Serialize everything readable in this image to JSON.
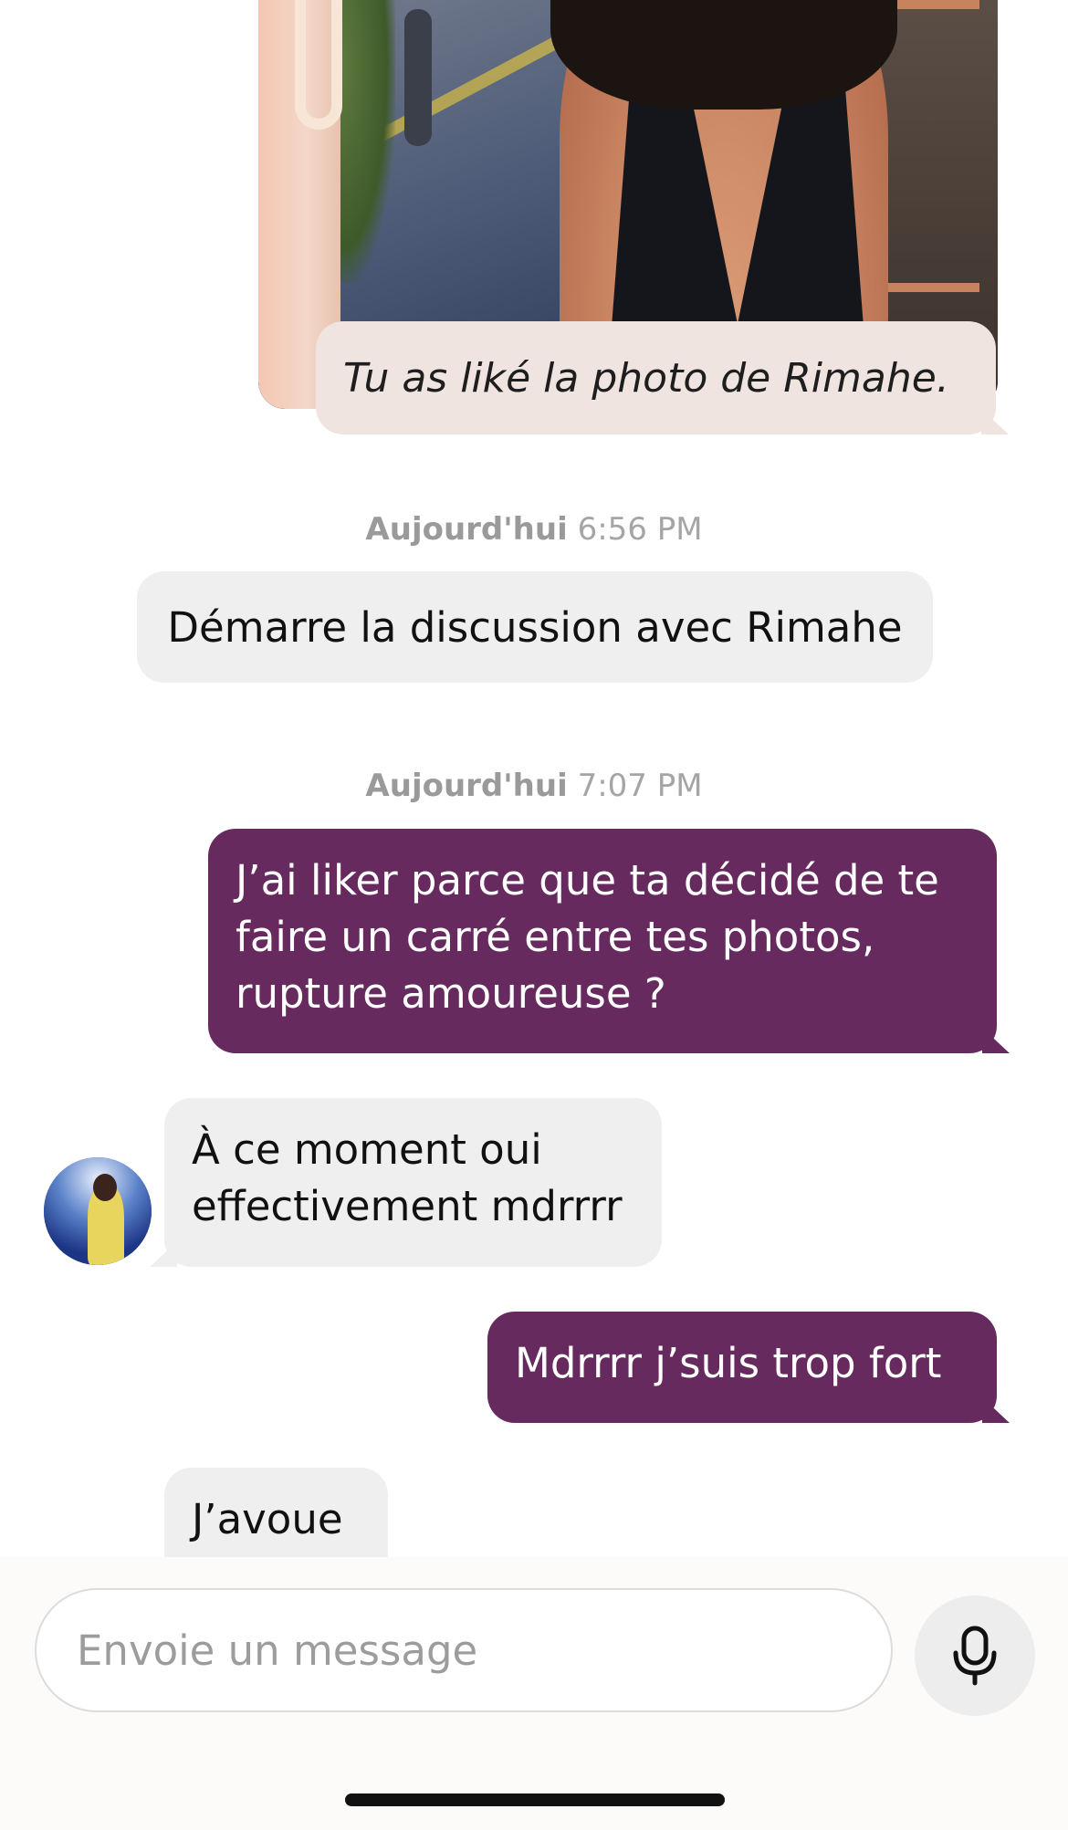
{
  "liked_photo": {
    "caption": "Tu as liké la photo de Rimahe."
  },
  "timestamps": [
    {
      "day": "Aujourd'hui",
      "time": "6:56 PM"
    },
    {
      "day": "Aujourd'hui",
      "time": "7:07 PM"
    }
  ],
  "system_message": "Démarre la discussion avec Rimahe",
  "messages": [
    {
      "direction": "outgoing",
      "text": "J’ai liker parce que ta décidé de te faire un carré entre tes photos, rupture amoureuse ?"
    },
    {
      "direction": "incoming",
      "text": "À ce moment oui effectivement mdrrrr"
    },
    {
      "direction": "outgoing",
      "text": "Mdrrrr j’suis trop fort"
    },
    {
      "direction": "incoming",
      "text": "J’avoue"
    }
  ],
  "composer": {
    "placeholder": "Envoie un message",
    "mic_icon": "microphone-icon"
  },
  "colors": {
    "outgoing_bubble": "#672a5e",
    "incoming_bubble": "#efefef",
    "liked_caption_bg": "#efe4df"
  }
}
